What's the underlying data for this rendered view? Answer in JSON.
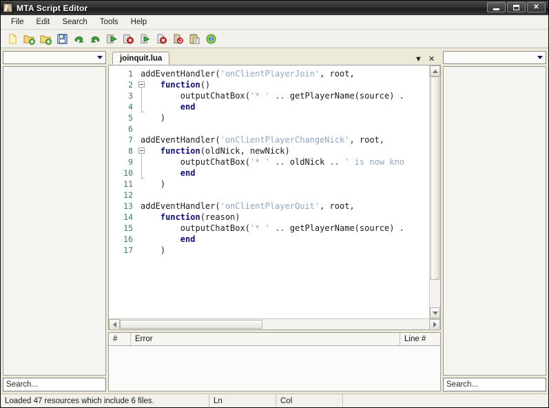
{
  "window": {
    "title": "MTA Script Editor",
    "icon": "mta-logo-icon",
    "buttons": {
      "minimize": "minimize-button",
      "maximize": "maximize-button",
      "close_label": "✕"
    }
  },
  "menubar": {
    "items": [
      {
        "label": "File",
        "name": "menu-file"
      },
      {
        "label": "Edit",
        "name": "menu-edit"
      },
      {
        "label": "Search",
        "name": "menu-search"
      },
      {
        "label": "Tools",
        "name": "menu-tools"
      },
      {
        "label": "Help",
        "name": "menu-help"
      }
    ]
  },
  "toolbar": {
    "buttons": [
      {
        "name": "new-file-icon",
        "title": "New file"
      },
      {
        "name": "open-file-icon",
        "title": "Open file"
      },
      {
        "name": "open-folder-icon",
        "title": "Open folder"
      },
      {
        "name": "save-icon",
        "title": "Save"
      },
      {
        "name": "undo-icon",
        "title": "Undo"
      },
      {
        "name": "redo-icon",
        "title": "Redo"
      },
      {
        "name": "start-resource-icon",
        "title": "Start resource"
      },
      {
        "name": "stop-resource-icon",
        "title": "Stop resource"
      },
      {
        "name": "start-script-icon",
        "title": "Start script"
      },
      {
        "name": "stop-script-icon",
        "title": "Stop script"
      },
      {
        "name": "refresh-resource-icon",
        "title": "Refresh resource"
      },
      {
        "name": "clipboard-icon",
        "title": "Paste"
      },
      {
        "name": "help-icon",
        "title": "Help"
      }
    ]
  },
  "left_panel": {
    "combo": {
      "value": "",
      "placeholder": ""
    },
    "list_items": [],
    "search": {
      "value": "Search..."
    }
  },
  "right_panel": {
    "combo": {
      "value": "",
      "placeholder": ""
    },
    "list_items": [],
    "search": {
      "value": "Search..."
    }
  },
  "editor": {
    "tabs": [
      {
        "label": "joinquit.lua",
        "active": true
      }
    ],
    "tab_actions": {
      "list_label": "▼",
      "close_label": "✕"
    },
    "total_lines": 17,
    "fold_lines": [
      2,
      8
    ],
    "lines": [
      {
        "n": 1,
        "tokens": [
          {
            "t": "addEventHandler(",
            "c": "plain"
          },
          {
            "t": "'onClientPlayerJoin'",
            "c": "str"
          },
          {
            "t": ", root,",
            "c": "plain"
          }
        ]
      },
      {
        "n": 2,
        "tokens": [
          {
            "t": "    ",
            "c": "plain"
          },
          {
            "t": "function",
            "c": "kw"
          },
          {
            "t": "()",
            "c": "plain"
          }
        ]
      },
      {
        "n": 3,
        "tokens": [
          {
            "t": "        outputChatBox(",
            "c": "plain"
          },
          {
            "t": "'* '",
            "c": "str"
          },
          {
            "t": " .. ",
            "c": "op"
          },
          {
            "t": "getPlayerName(source) .",
            "c": "plain"
          }
        ]
      },
      {
        "n": 4,
        "tokens": [
          {
            "t": "        ",
            "c": "plain"
          },
          {
            "t": "end",
            "c": "kw"
          }
        ]
      },
      {
        "n": 5,
        "tokens": [
          {
            "t": "    )",
            "c": "plain"
          }
        ]
      },
      {
        "n": 6,
        "tokens": [
          {
            "t": "",
            "c": "plain"
          }
        ]
      },
      {
        "n": 7,
        "tokens": [
          {
            "t": "addEventHandler(",
            "c": "plain"
          },
          {
            "t": "'onClientPlayerChangeNick'",
            "c": "str"
          },
          {
            "t": ", root,",
            "c": "plain"
          }
        ]
      },
      {
        "n": 8,
        "tokens": [
          {
            "t": "    ",
            "c": "plain"
          },
          {
            "t": "function",
            "c": "kw"
          },
          {
            "t": "(oldNick, newNick)",
            "c": "plain"
          }
        ]
      },
      {
        "n": 9,
        "tokens": [
          {
            "t": "        outputChatBox(",
            "c": "plain"
          },
          {
            "t": "'* '",
            "c": "str"
          },
          {
            "t": " .. ",
            "c": "op"
          },
          {
            "t": "oldNick ",
            "c": "plain"
          },
          {
            "t": ".. ",
            "c": "op"
          },
          {
            "t": "' is now kno",
            "c": "str"
          }
        ]
      },
      {
        "n": 10,
        "tokens": [
          {
            "t": "        ",
            "c": "plain"
          },
          {
            "t": "end",
            "c": "kw"
          }
        ]
      },
      {
        "n": 11,
        "tokens": [
          {
            "t": "    )",
            "c": "plain"
          }
        ]
      },
      {
        "n": 12,
        "tokens": [
          {
            "t": "",
            "c": "plain"
          }
        ]
      },
      {
        "n": 13,
        "tokens": [
          {
            "t": "addEventHandler(",
            "c": "plain"
          },
          {
            "t": "'onClientPlayerQuit'",
            "c": "str"
          },
          {
            "t": ", root,",
            "c": "plain"
          }
        ]
      },
      {
        "n": 14,
        "tokens": [
          {
            "t": "    ",
            "c": "plain"
          },
          {
            "t": "function",
            "c": "kw"
          },
          {
            "t": "(reason)",
            "c": "plain"
          }
        ]
      },
      {
        "n": 15,
        "tokens": [
          {
            "t": "        outputChatBox(",
            "c": "plain"
          },
          {
            "t": "'* '",
            "c": "str"
          },
          {
            "t": " .. ",
            "c": "op"
          },
          {
            "t": "getPlayerName(source) .",
            "c": "plain"
          }
        ]
      },
      {
        "n": 16,
        "tokens": [
          {
            "t": "        ",
            "c": "plain"
          },
          {
            "t": "end",
            "c": "kw"
          }
        ]
      },
      {
        "n": 17,
        "tokens": [
          {
            "t": "    )",
            "c": "plain"
          }
        ]
      }
    ]
  },
  "error_grid": {
    "columns": [
      {
        "label": "#",
        "name": "error-col-number"
      },
      {
        "label": "Error",
        "name": "error-col-message"
      },
      {
        "label": "Line #",
        "name": "error-col-line"
      }
    ],
    "rows": []
  },
  "statusbar": {
    "message": "Loaded 47 resources which include 6 files.",
    "line_label": "Ln",
    "col_label": "Col",
    "extra": ""
  },
  "colors": {
    "window_bg": "#ece9d8",
    "titlebar": "#2e2e2e",
    "keyword": "#10107a",
    "string": "#8ea7c4",
    "operator": "#7a3030",
    "line_number": "#2e7d6f",
    "editor_bg": "#ffffff"
  }
}
